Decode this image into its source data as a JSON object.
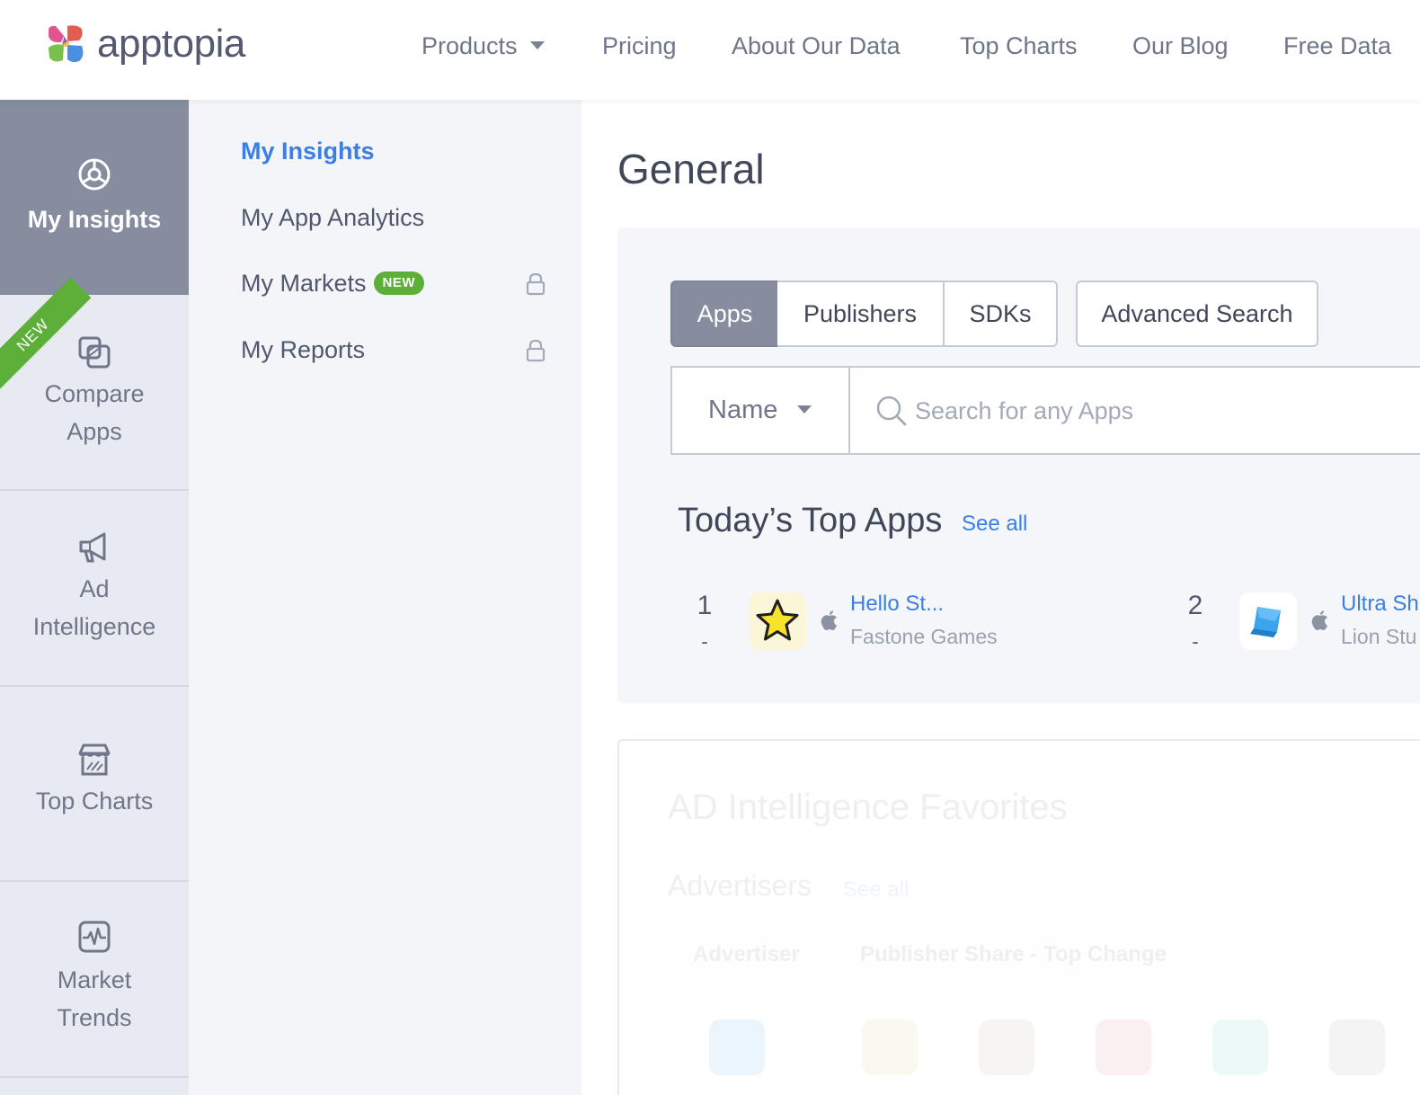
{
  "brand": {
    "name": "apptopia"
  },
  "nav": {
    "products": "Products",
    "pricing": "Pricing",
    "about": "About Our Data",
    "top_charts": "Top Charts",
    "blog": "Our Blog",
    "free_data": "Free Data"
  },
  "rail": {
    "items": [
      {
        "label": "My Insights",
        "icon": "insights-icon",
        "active": true
      },
      {
        "label_line1": "Compare",
        "label_line2": "Apps",
        "icon": "compare-icon",
        "ribbon": "NEW"
      },
      {
        "label_line1": "Ad",
        "label_line2": "Intelligence",
        "icon": "megaphone-icon"
      },
      {
        "label": "Top Charts",
        "icon": "storefront-icon"
      },
      {
        "label_line1": "Market",
        "label_line2": "Trends",
        "icon": "pulse-icon"
      }
    ]
  },
  "submenu": {
    "items": [
      {
        "label": "My Insights",
        "active": true
      },
      {
        "label": "My App Analytics"
      },
      {
        "label": "My Markets",
        "badge": "NEW",
        "locked": true
      },
      {
        "label": "My Reports",
        "locked": true
      }
    ]
  },
  "main": {
    "title": "General",
    "search": {
      "tabs": [
        "Apps",
        "Publishers",
        "SDKs"
      ],
      "active_tab": "Apps",
      "advanced": "Advanced Search",
      "field": "Name",
      "placeholder": "Search for any Apps"
    },
    "top_apps": {
      "title": "Today’s Top Apps",
      "see_all": "See all",
      "apps": [
        {
          "rank": "1",
          "change": "-",
          "name": "Hello St...",
          "publisher": "Fastone Games",
          "platform": "apple-icon",
          "icon": "star-icon"
        },
        {
          "rank": "2",
          "change": "-",
          "name": "Ultra Sh",
          "publisher": "Lion Stu",
          "platform": "apple-icon",
          "icon": "blue-cube-icon"
        }
      ]
    },
    "ad_intelligence": {
      "title": "AD Intelligence Favorites",
      "subtitle": "Advertisers",
      "see_all": "See all",
      "columns": [
        "Advertiser",
        "Publisher Share - Top Change"
      ]
    }
  },
  "colors": {
    "accent_blue": "#3a7fe6",
    "new_green": "#5cb039",
    "rail_active": "#858d9e",
    "rail_bg": "#e7eaf0",
    "submenu_bg": "#f3f5f9"
  }
}
